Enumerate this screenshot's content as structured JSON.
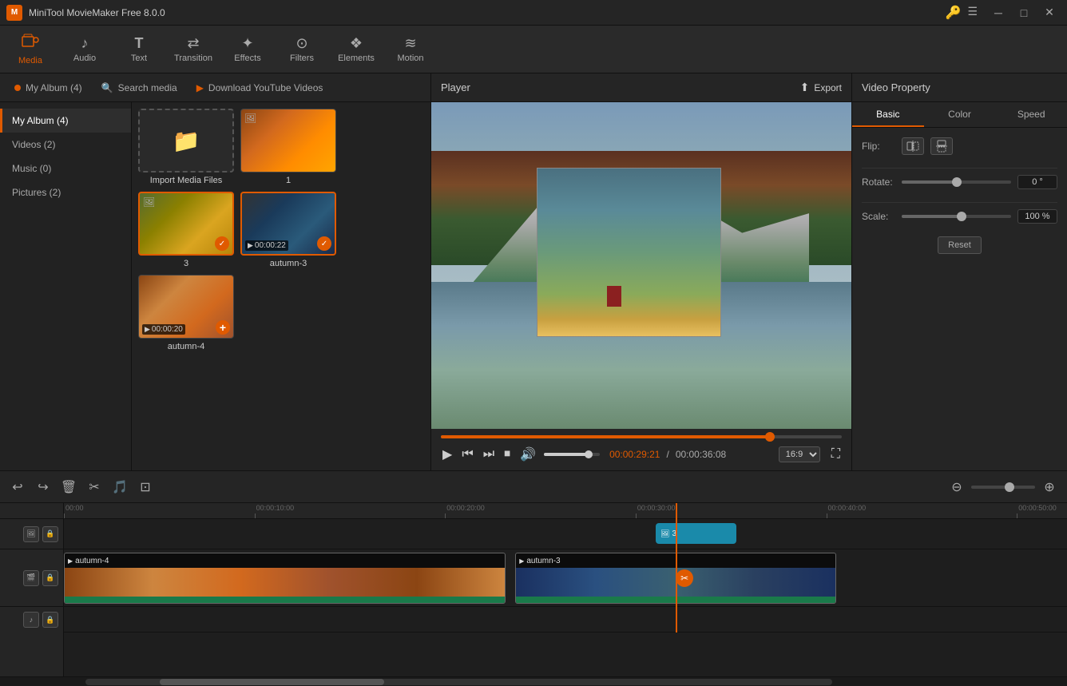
{
  "app": {
    "title": "MiniTool MovieMaker Free 8.0.0",
    "logo": "M"
  },
  "titlebar": {
    "minimize": "─",
    "maximize": "□",
    "close": "✕",
    "settings_icon": "☰",
    "key_icon": "🔑"
  },
  "toolbar": {
    "items": [
      {
        "id": "media",
        "label": "Media",
        "icon": "🎬",
        "active": true
      },
      {
        "id": "audio",
        "label": "Audio",
        "icon": "♪"
      },
      {
        "id": "text",
        "label": "Text",
        "icon": "T"
      },
      {
        "id": "transition",
        "label": "Transition",
        "icon": "⇄"
      },
      {
        "id": "effects",
        "label": "Effects",
        "icon": "✦"
      },
      {
        "id": "filters",
        "label": "Filters",
        "icon": "⊙"
      },
      {
        "id": "elements",
        "label": "Elements",
        "icon": "❖"
      },
      {
        "id": "motion",
        "label": "Motion",
        "icon": "≋"
      }
    ]
  },
  "left_panel": {
    "search_placeholder": "Search media",
    "yt_label": "Download YouTube Videos",
    "sidebar": {
      "items": [
        {
          "id": "my_album",
          "label": "My Album (4)",
          "active": true
        },
        {
          "id": "videos",
          "label": "Videos (2)"
        },
        {
          "id": "music",
          "label": "Music (0)"
        },
        {
          "id": "pictures",
          "label": "Pictures (2)"
        }
      ]
    },
    "media_items": [
      {
        "id": "import",
        "type": "import",
        "label": "Import Media Files"
      },
      {
        "id": "1",
        "type": "image",
        "label": "1",
        "thumb": "thumb-1"
      },
      {
        "id": "3",
        "type": "image",
        "label": "3",
        "thumb": "thumb-3",
        "selected": true
      },
      {
        "id": "autumn3",
        "type": "video",
        "label": "autumn-3",
        "duration": "00:00:22",
        "thumb": "thumb-autumn3",
        "selected": true
      },
      {
        "id": "autumn4",
        "type": "video",
        "label": "autumn-4",
        "duration": "00:00:20",
        "thumb": "thumb-autumn4"
      }
    ]
  },
  "player": {
    "title": "Player",
    "export_label": "Export",
    "time_current": "00:00:29:21",
    "time_total": "00:00:36:08",
    "aspect_ratio": "16:9",
    "controls": {
      "play": "▶",
      "prev": "⏮",
      "next": "⏭",
      "stop": "⏹",
      "volume": "🔊",
      "fullscreen": "⛶"
    }
  },
  "video_property": {
    "title": "Video Property",
    "tabs": [
      "Basic",
      "Color",
      "Speed"
    ],
    "active_tab": "Basic",
    "flip_label": "Flip:",
    "rotate_label": "Rotate:",
    "scale_label": "Scale:",
    "rotate_value": "0 °",
    "scale_value": "100 %",
    "reset_label": "Reset"
  },
  "timeline": {
    "toolbar": {
      "undo": "↩",
      "redo": "↪",
      "delete": "🗑",
      "cut": "✂",
      "audio": "🎵",
      "crop": "⊡"
    },
    "ruler_marks": [
      {
        "label": "00:00",
        "pos": 0
      },
      {
        "label": "00:00:10:00",
        "pos": 20
      },
      {
        "label": "00:00:20:00",
        "pos": 40
      },
      {
        "label": "00:00:30:00",
        "pos": 60
      },
      {
        "label": "00:00:40:00",
        "pos": 80
      },
      {
        "label": "00:00:50:00",
        "pos": 100
      }
    ],
    "tracks": {
      "img_clip": {
        "label": "3",
        "left_pct": 62,
        "width_pct": 7
      },
      "video_clips": [
        {
          "id": "autumn4",
          "label": "autumn-4",
          "left_pct": 0,
          "width_pct": 45,
          "thumb": "thumb-autumn4"
        },
        {
          "id": "autumn3",
          "label": "autumn-3",
          "left_pct": 46,
          "width_pct": 31,
          "thumb": "thumb-autumn3"
        }
      ],
      "playhead_pct": 62
    }
  }
}
